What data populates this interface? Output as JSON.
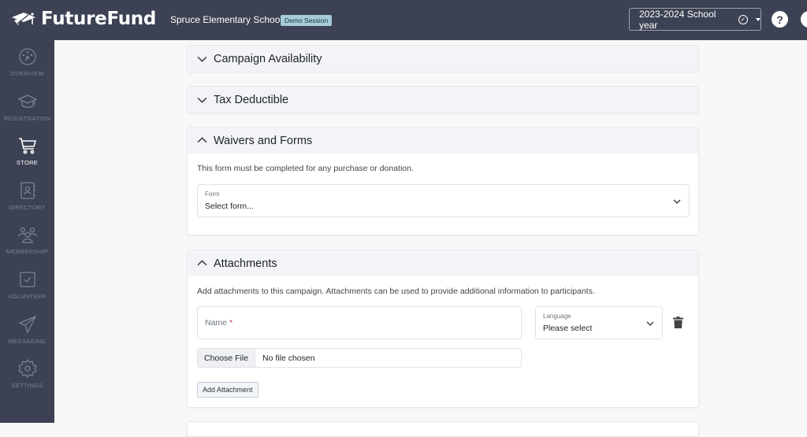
{
  "header": {
    "brand": "FutureFund",
    "school": "Spruce Elementary School",
    "session_badge": "Demo Session",
    "school_year": "2023-2024 School year",
    "help_label": "?"
  },
  "sidebar": {
    "items": [
      {
        "label": "OVERVIEW",
        "icon": "dashboard-gauge-icon",
        "active": false
      },
      {
        "label": "REGISTRATION",
        "icon": "graduation-cap-icon",
        "active": false
      },
      {
        "label": "STORE",
        "icon": "cart-icon",
        "active": true
      },
      {
        "label": "DIRECTORY",
        "icon": "contact-book-icon",
        "active": false
      },
      {
        "label": "MEMBERSHIP",
        "icon": "users-group-icon",
        "active": false
      },
      {
        "label": "VOLUNTEER",
        "icon": "checkbox-icon",
        "active": false
      },
      {
        "label": "MESSAGING",
        "icon": "paper-plane-icon",
        "active": false
      },
      {
        "label": "SETTINGS",
        "icon": "gear-icon",
        "active": false
      }
    ]
  },
  "sections": {
    "campaign_availability": {
      "title": "Campaign Availability",
      "expanded": false
    },
    "tax_deductible": {
      "title": "Tax Deductible",
      "expanded": false
    },
    "waivers": {
      "title": "Waivers and Forms",
      "expanded": true,
      "description": "This form must be completed for any purchase or donation.",
      "form_label": "Form",
      "form_value": "Select form..."
    },
    "attachments": {
      "title": "Attachments",
      "expanded": true,
      "description": "Add attachments to this campaign. Attachments can be used to provide additional information to participants.",
      "name_placeholder": "Name",
      "name_required_mark": "*",
      "language_label": "Language",
      "language_value": "Please select",
      "choose_file_label": "Choose File",
      "file_status": "No file chosen",
      "add_button": "Add Attachment"
    }
  }
}
